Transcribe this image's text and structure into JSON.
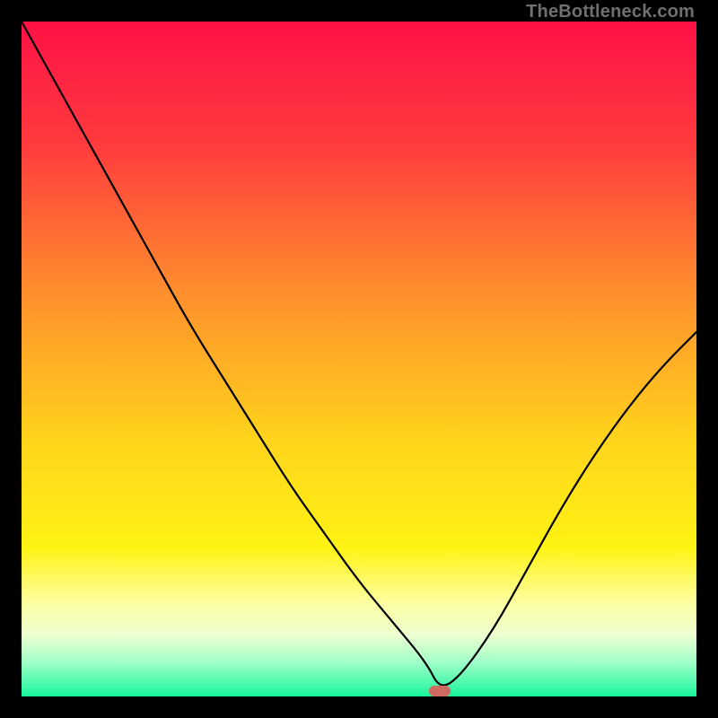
{
  "watermark": "TheBottleneck.com",
  "chart_data": {
    "type": "line",
    "title": "",
    "xlabel": "",
    "ylabel": "",
    "xlim": [
      0,
      100
    ],
    "ylim": [
      0,
      100
    ],
    "grid": false,
    "series": [
      {
        "name": "bottleneck-curve",
        "x": [
          0,
          5,
          10,
          15,
          20,
          25,
          30,
          35,
          40,
          45,
          50,
          55,
          60,
          62,
          65,
          70,
          75,
          80,
          85,
          90,
          95,
          100
        ],
        "values": [
          100,
          91,
          82,
          73,
          64,
          55,
          47,
          39,
          31,
          24,
          17,
          11,
          5,
          1,
          3,
          10,
          19,
          28,
          36,
          43,
          49,
          54
        ]
      }
    ],
    "marker": {
      "name": "optimal-point",
      "x": 62,
      "y": 0.8,
      "width_pct": 3.2,
      "height_pct": 1.6,
      "color": "#cf6a61"
    },
    "gradient_stops": [
      {
        "pct": 0,
        "color": "#ff1146"
      },
      {
        "pct": 18,
        "color": "#ff3a3e"
      },
      {
        "pct": 40,
        "color": "#ff8e2d"
      },
      {
        "pct": 62,
        "color": "#ffd41c"
      },
      {
        "pct": 78,
        "color": "#fff314"
      },
      {
        "pct": 86,
        "color": "#feffa0"
      },
      {
        "pct": 91,
        "color": "#ecffd1"
      },
      {
        "pct": 95,
        "color": "#9fffc8"
      },
      {
        "pct": 100,
        "color": "#17f59a"
      }
    ]
  }
}
